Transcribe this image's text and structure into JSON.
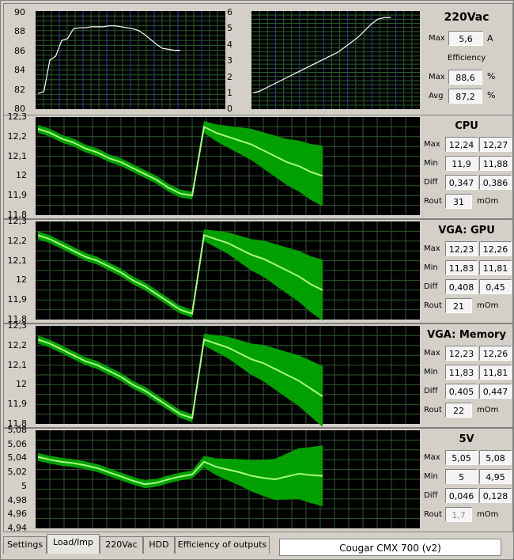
{
  "top": {
    "eff_left_ticks": [
      "90",
      "88",
      "86",
      "84",
      "82",
      "80"
    ],
    "eff_right_ticks": [
      "6",
      "5",
      "4",
      "3",
      "2",
      "1",
      "0"
    ],
    "ac_panel": {
      "title": "220Vac",
      "max_label": "Max",
      "current_max": "5,6",
      "current_unit": "A",
      "efficiency_title": "Efficiency",
      "eff_max_label": "Max",
      "eff_max": "88,6",
      "eff_avg_label": "Avg",
      "eff_avg": "87,2",
      "pct": "%"
    }
  },
  "rails": [
    {
      "title": "CPU",
      "ticks": [
        "12,3",
        "12,2",
        "12,1",
        "12",
        "11,9",
        "11,8"
      ],
      "max_label": "Max",
      "max_a": "12,24",
      "max_b": "12,27",
      "min_label": "Min",
      "min_a": "11,9",
      "min_b": "11,88",
      "diff_label": "Diff",
      "diff_a": "0,347",
      "diff_b": "0,386",
      "rout_label": "Rout",
      "rout": "31",
      "rout_unit": "mOm",
      "rout_gray": false
    },
    {
      "title": "VGA: GPU",
      "ticks": [
        "12,3",
        "12,2",
        "12,1",
        "12",
        "11,9",
        "11,8"
      ],
      "max_label": "Max",
      "max_a": "12,23",
      "max_b": "12,26",
      "min_label": "Min",
      "min_a": "11,83",
      "min_b": "11,81",
      "diff_label": "Diff",
      "diff_a": "0,408",
      "diff_b": "0,45",
      "rout_label": "Rout",
      "rout": "21",
      "rout_unit": "mOm",
      "rout_gray": false
    },
    {
      "title": "VGA: Memory",
      "ticks": [
        "12,3",
        "12,2",
        "12,1",
        "12",
        "11,9",
        "11,8"
      ],
      "max_label": "Max",
      "max_a": "12,23",
      "max_b": "12,26",
      "min_label": "Min",
      "min_a": "11,83",
      "min_b": "11,81",
      "diff_label": "Diff",
      "diff_a": "0,405",
      "diff_b": "0,447",
      "rout_label": "Rout",
      "rout": "22",
      "rout_unit": "mOm",
      "rout_gray": false
    },
    {
      "title": "5V",
      "ticks": [
        "5,08",
        "5,06",
        "5,04",
        "5,02",
        "5",
        "4,98",
        "4,96",
        "4,94"
      ],
      "max_label": "Max",
      "max_a": "5,05",
      "max_b": "5,08",
      "min_label": "Min",
      "min_a": "5",
      "min_b": "4,95",
      "diff_label": "Diff",
      "diff_a": "0,046",
      "diff_b": "0,128",
      "rout_label": "Rout",
      "rout": "1,7",
      "rout_unit": "mOm",
      "rout_gray": true
    }
  ],
  "tabs": [
    "Settings",
    "Load/Imp",
    "220Vac",
    "HDD",
    "Efficiency of outputs"
  ],
  "active_tab": "Load/Imp",
  "model_name": "Cougar CMX 700 (v2)",
  "colors": {
    "plot_bg": "#000000",
    "grid_green": "#2e5a2e",
    "grid_blue": "#2b3cb0",
    "band": "#00a000",
    "line": "#a8ff80",
    "trace_white": "#ffffff"
  },
  "chart_data": [
    {
      "type": "line",
      "title": "",
      "xlabel": "",
      "ylabel": "",
      "ylim": [
        80,
        90
      ],
      "y2lim": [
        0,
        6
      ],
      "series": [
        {
          "values": [
            81.6,
            81.8,
            85.0,
            85.4,
            87.0,
            87.2,
            88.2,
            88.3,
            88.3,
            88.4,
            88.4,
            88.4,
            88.5,
            88.5,
            88.4,
            88.3,
            88.2,
            88.0,
            87.6,
            87.1,
            86.6,
            86.2,
            86.1,
            86.0,
            86.0
          ]
        },
        {
          "values": [
            1.0,
            1.1,
            1.3,
            1.5,
            1.7,
            1.9,
            2.1,
            2.3,
            2.5,
            2.7,
            2.9,
            3.1,
            3.3,
            3.5,
            3.8,
            4.1,
            4.4,
            4.8,
            5.2,
            5.5,
            5.6,
            5.6
          ]
        }
      ]
    },
    {
      "type": "area",
      "ylim": [
        11.8,
        12.3
      ],
      "series": [
        {
          "values": [
            12.24,
            12.22,
            12.19,
            12.17,
            12.14,
            12.12,
            12.09,
            12.07,
            12.04,
            12.01,
            11.98,
            11.94,
            11.91,
            11.9,
            12.25,
            12.22,
            12.2,
            12.18,
            12.16,
            12.13,
            12.1,
            12.07,
            12.05,
            12.02,
            12.0
          ]
        }
      ]
    },
    {
      "type": "area",
      "ylim": [
        11.8,
        12.3
      ],
      "series": [
        {
          "values": [
            12.23,
            12.21,
            12.18,
            12.15,
            12.12,
            12.1,
            12.07,
            12.04,
            12.0,
            11.97,
            11.93,
            11.89,
            11.85,
            11.83,
            12.23,
            12.21,
            12.19,
            12.16,
            12.13,
            12.11,
            12.08,
            12.05,
            12.02,
            11.98,
            11.95
          ]
        }
      ]
    },
    {
      "type": "area",
      "ylim": [
        11.8,
        12.3
      ],
      "series": [
        {
          "values": [
            12.23,
            12.21,
            12.18,
            12.15,
            12.12,
            12.1,
            12.07,
            12.04,
            12.0,
            11.97,
            11.93,
            11.89,
            11.85,
            11.83,
            12.23,
            12.21,
            12.19,
            12.16,
            12.13,
            12.11,
            12.08,
            12.05,
            12.02,
            11.98,
            11.94
          ]
        }
      ]
    },
    {
      "type": "area",
      "ylim": [
        4.94,
        5.08
      ],
      "series": [
        {
          "values": [
            5.042,
            5.038,
            5.035,
            5.033,
            5.03,
            5.026,
            5.02,
            5.014,
            5.008,
            5.003,
            5.005,
            5.01,
            5.014,
            5.017,
            5.035,
            5.028,
            5.024,
            5.02,
            5.015,
            5.012,
            5.01,
            5.014,
            5.018,
            5.016,
            5.015
          ]
        }
      ]
    }
  ]
}
